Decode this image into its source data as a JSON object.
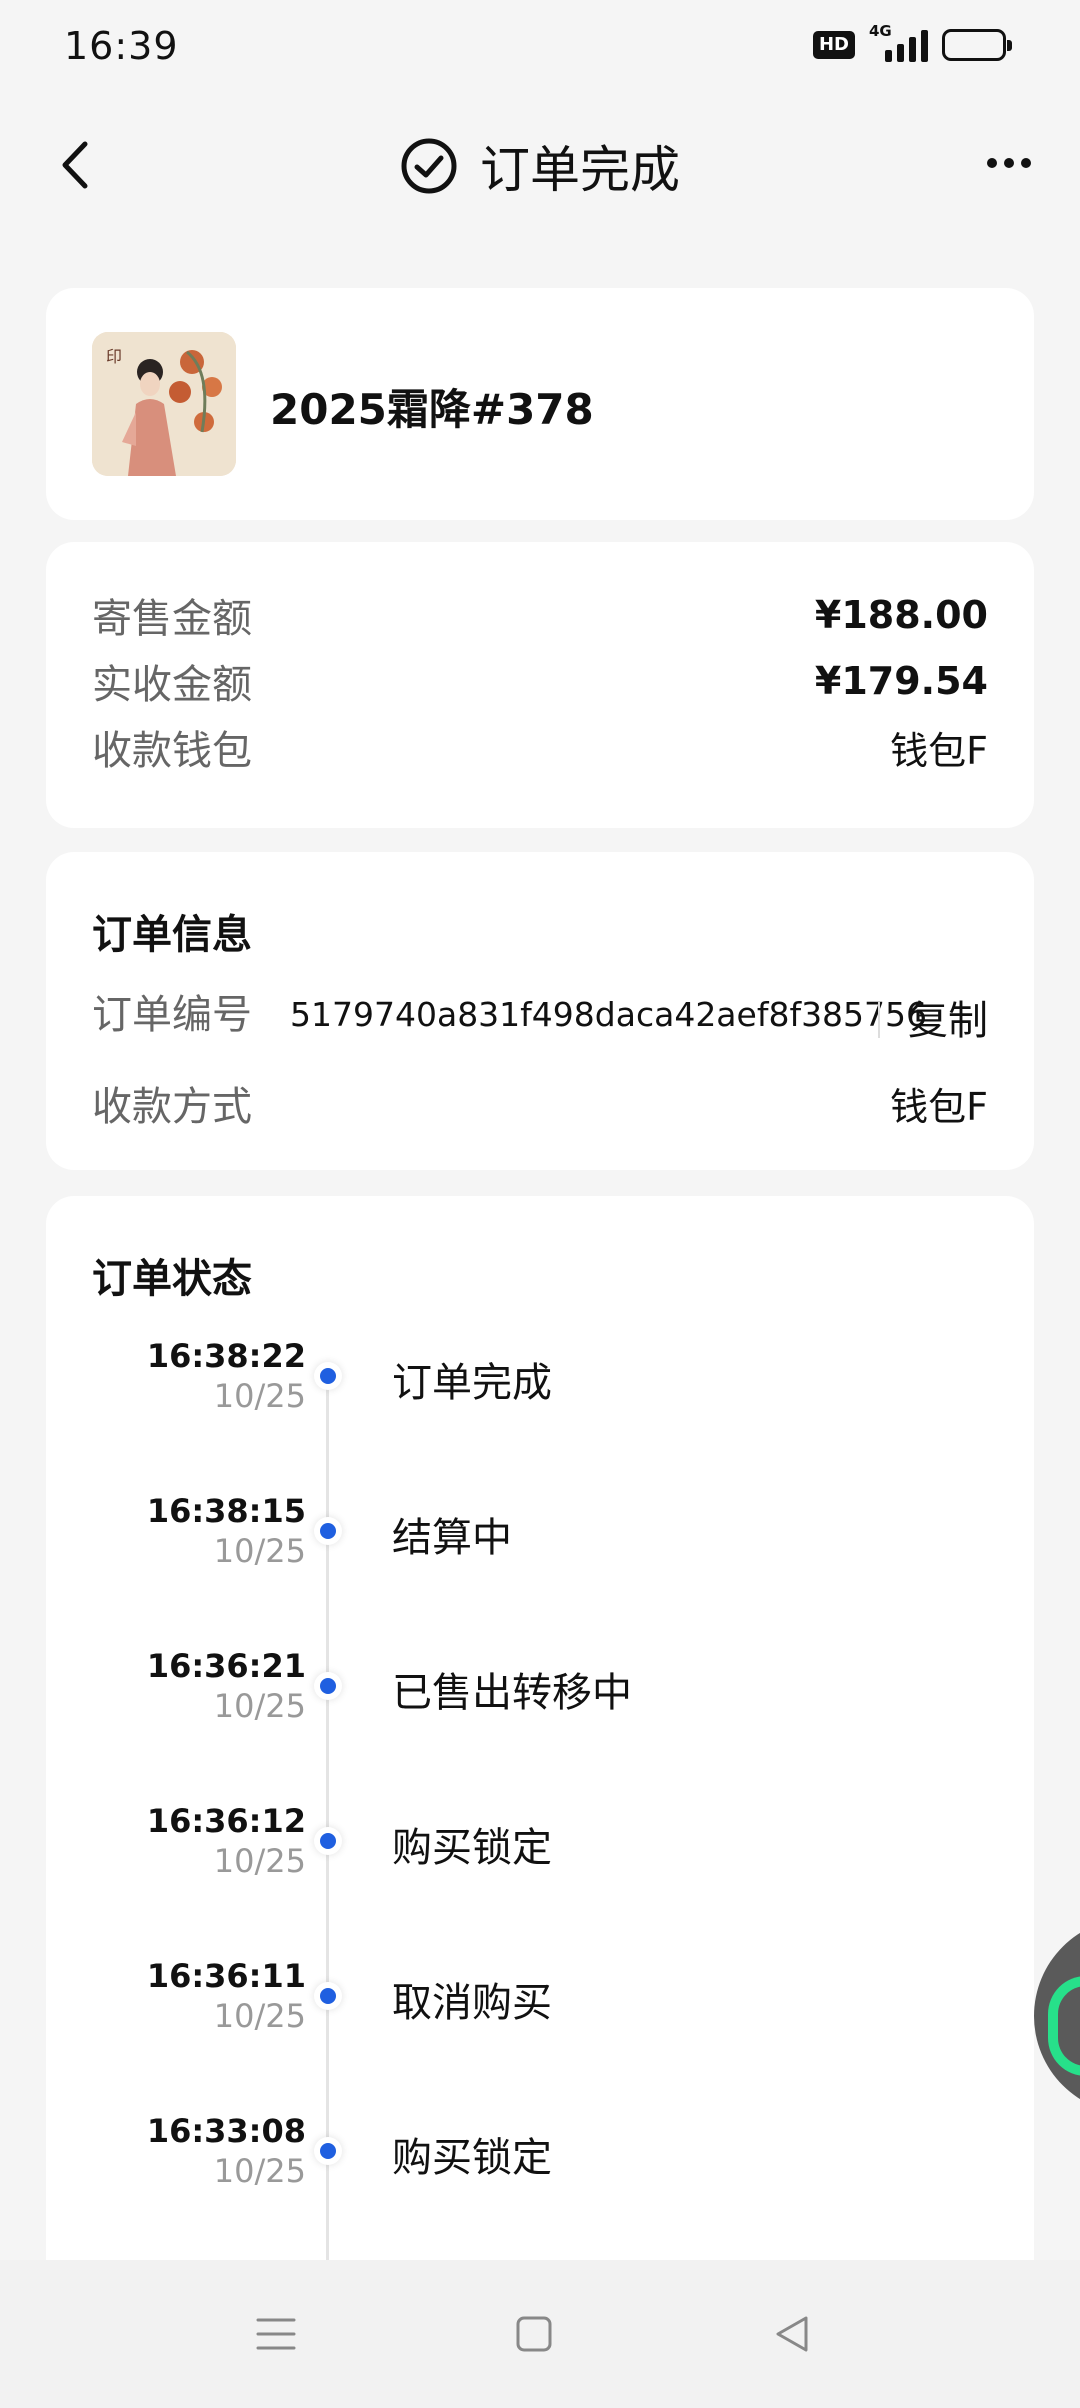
{
  "status_bar": {
    "time": "16:39",
    "hd_badge": "HD",
    "network": "4G"
  },
  "header": {
    "title": "订单完成"
  },
  "product": {
    "name": "2025霜降#378"
  },
  "amounts": {
    "rows": [
      {
        "label": "寄售金额",
        "value": "¥188.00"
      },
      {
        "label": "实收金额",
        "value": "¥179.54"
      },
      {
        "label": "收款钱包",
        "value": "钱包F"
      }
    ]
  },
  "order_info": {
    "title": "订单信息",
    "order_no_label": "订单编号",
    "order_no": "5179740a831f498daca42aef8f385756",
    "copy_label": "复制",
    "payment_label": "收款方式",
    "payment_value": "钱包F"
  },
  "order_status": {
    "title": "订单状态",
    "items": [
      {
        "time": "16:38:22",
        "date": "10/25",
        "label": "订单完成"
      },
      {
        "time": "16:38:15",
        "date": "10/25",
        "label": "结算中"
      },
      {
        "time": "16:36:21",
        "date": "10/25",
        "label": "已售出转移中"
      },
      {
        "time": "16:36:12",
        "date": "10/25",
        "label": "购买锁定"
      },
      {
        "time": "16:36:11",
        "date": "10/25",
        "label": "取消购买"
      },
      {
        "time": "16:33:08",
        "date": "10/25",
        "label": "购买锁定"
      }
    ]
  },
  "colors": {
    "accent_dot": "#1f5fe0",
    "background": "#f5f5f5",
    "card": "#ffffff"
  }
}
